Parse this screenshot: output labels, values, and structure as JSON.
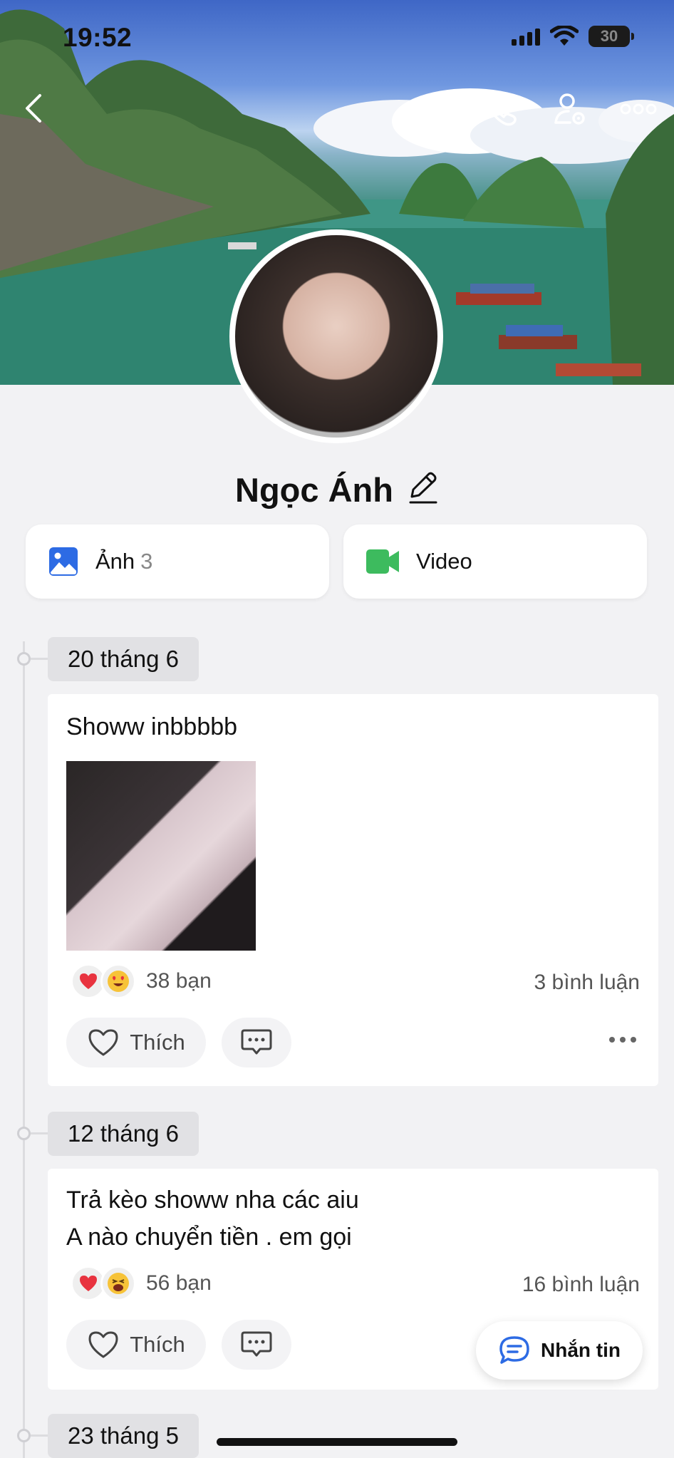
{
  "status_bar": {
    "time": "19:52",
    "battery_level": "30"
  },
  "header": {
    "back_icon": "chevron-left-icon",
    "call_icon": "phone-icon",
    "settings_icon": "user-settings-icon",
    "more_icon": "more-horizontal-icon"
  },
  "profile": {
    "name": "Ngọc Ánh",
    "edit_icon": "pencil-icon"
  },
  "media": {
    "photos_label": "Ảnh",
    "photos_count": "3",
    "videos_label": "Video"
  },
  "posts": [
    {
      "date": "20 tháng 6",
      "text_lines": [
        "Showw inbbbbb"
      ],
      "has_image": true,
      "reactions": [
        "heart",
        "heart-eyes"
      ],
      "reaction_count": "38 bạn",
      "comment_count": "3 bình luận",
      "like_label": "Thích"
    },
    {
      "date": "12 tháng 6",
      "text_lines": [
        "Trả kèo showw nha các aiu",
        "A nào chuyển tiền . em gọi"
      ],
      "has_image": false,
      "reactions": [
        "heart",
        "laughing"
      ],
      "reaction_count": "56 bạn",
      "comment_count": "16 bình luận",
      "like_label": "Thích"
    },
    {
      "date": "23 tháng 5"
    }
  ],
  "floating": {
    "message_label": "Nhắn tin"
  },
  "colors": {
    "background": "#f2f2f4",
    "card": "#ffffff",
    "photo_icon": "#2d6be4",
    "video_icon": "#3dbb5e",
    "heart": "#e8333f",
    "message_icon": "#2d6be4"
  }
}
